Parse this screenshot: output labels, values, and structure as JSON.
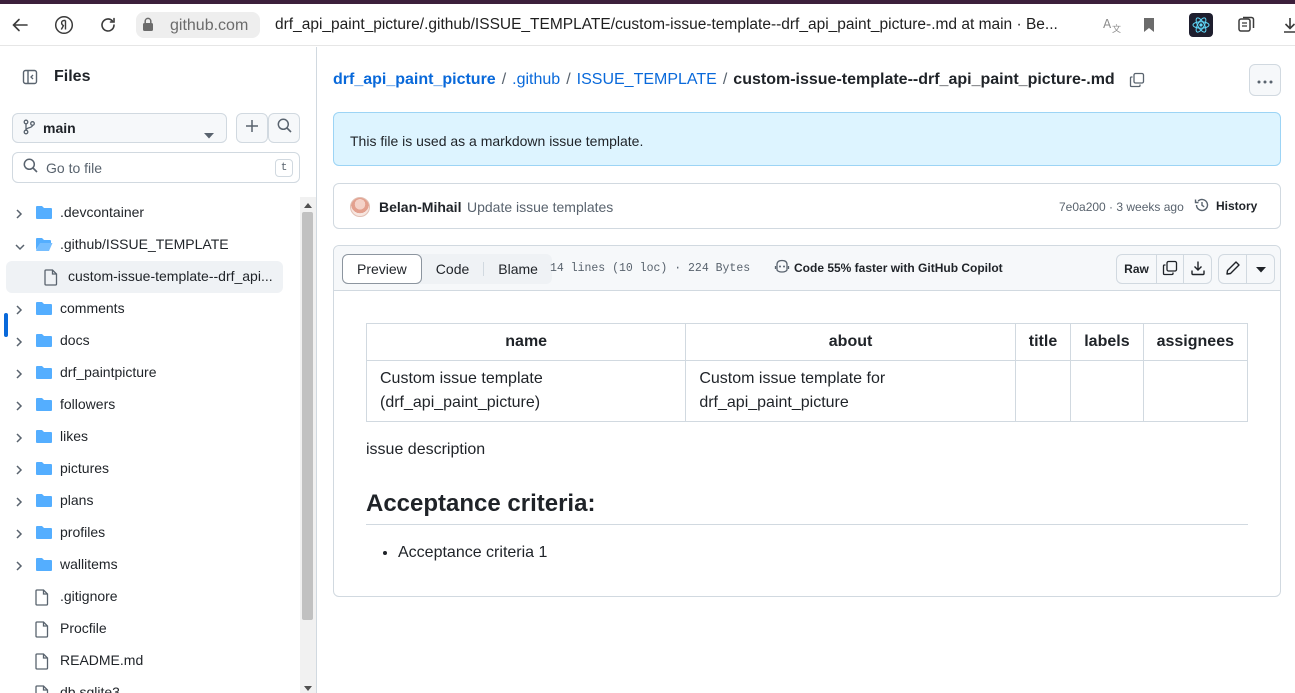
{
  "browser": {
    "domain": "github.com",
    "title": "drf_api_paint_picture/.github/ISSUE_TEMPLATE/custom-issue-template--drf_api_paint_picture-.md at main · Be..."
  },
  "sidebar": {
    "title": "Files",
    "branch": "main",
    "goto_placeholder": "Go to file",
    "goto_shortcut": "t",
    "items": [
      {
        "name": ".devcontainer",
        "type": "folder",
        "expanded": false
      },
      {
        "name": ".github/ISSUE_TEMPLATE",
        "type": "folder",
        "expanded": true
      },
      {
        "name": "custom-issue-template--drf_api...",
        "type": "file",
        "selected": true
      },
      {
        "name": "comments",
        "type": "folder",
        "expanded": false
      },
      {
        "name": "docs",
        "type": "folder",
        "expanded": false
      },
      {
        "name": "drf_paintpicture",
        "type": "folder",
        "expanded": false
      },
      {
        "name": "followers",
        "type": "folder",
        "expanded": false
      },
      {
        "name": "likes",
        "type": "folder",
        "expanded": false
      },
      {
        "name": "pictures",
        "type": "folder",
        "expanded": false
      },
      {
        "name": "plans",
        "type": "folder",
        "expanded": false
      },
      {
        "name": "profiles",
        "type": "folder",
        "expanded": false
      },
      {
        "name": "wallitems",
        "type": "folder",
        "expanded": false
      },
      {
        "name": ".gitignore",
        "type": "file"
      },
      {
        "name": "Procfile",
        "type": "file"
      },
      {
        "name": "README.md",
        "type": "file"
      },
      {
        "name": "db.sqlite3",
        "type": "file"
      }
    ]
  },
  "breadcrumb": {
    "repo": "drf_api_paint_picture",
    "dir1": ".github",
    "dir2": "ISSUE_TEMPLATE",
    "file": "custom-issue-template--drf_api_paint_picture-.md",
    "sep": "/"
  },
  "flash": "This file is used as a markdown issue template.",
  "commit": {
    "author": "Belan-Mihail",
    "message": "Update issue templates",
    "meta": "7e0a200 · 3 weeks ago",
    "history_label": "History"
  },
  "file": {
    "tabs": [
      "Preview",
      "Code",
      "Blame"
    ],
    "active_tab": "Preview",
    "meta": "14 lines (10 loc) · 224 Bytes",
    "copilot": "Code 55% faster with GitHub Copilot",
    "raw_label": "Raw"
  },
  "markdown": {
    "table": {
      "headers": [
        "name",
        "about",
        "title",
        "labels",
        "assignees"
      ],
      "rows": [
        [
          "Custom issue template (drf_api_paint_picture)",
          "Custom issue template for drf_api_paint_picture",
          "",
          "",
          ""
        ]
      ]
    },
    "paragraph": "issue description",
    "heading": "Acceptance criteria:",
    "list": [
      "Acceptance criteria 1"
    ]
  },
  "colors": {
    "accent": "#0969da",
    "flash_bg": "#ddf4ff",
    "folder": "#54aeff",
    "border": "#d1d9e0"
  }
}
